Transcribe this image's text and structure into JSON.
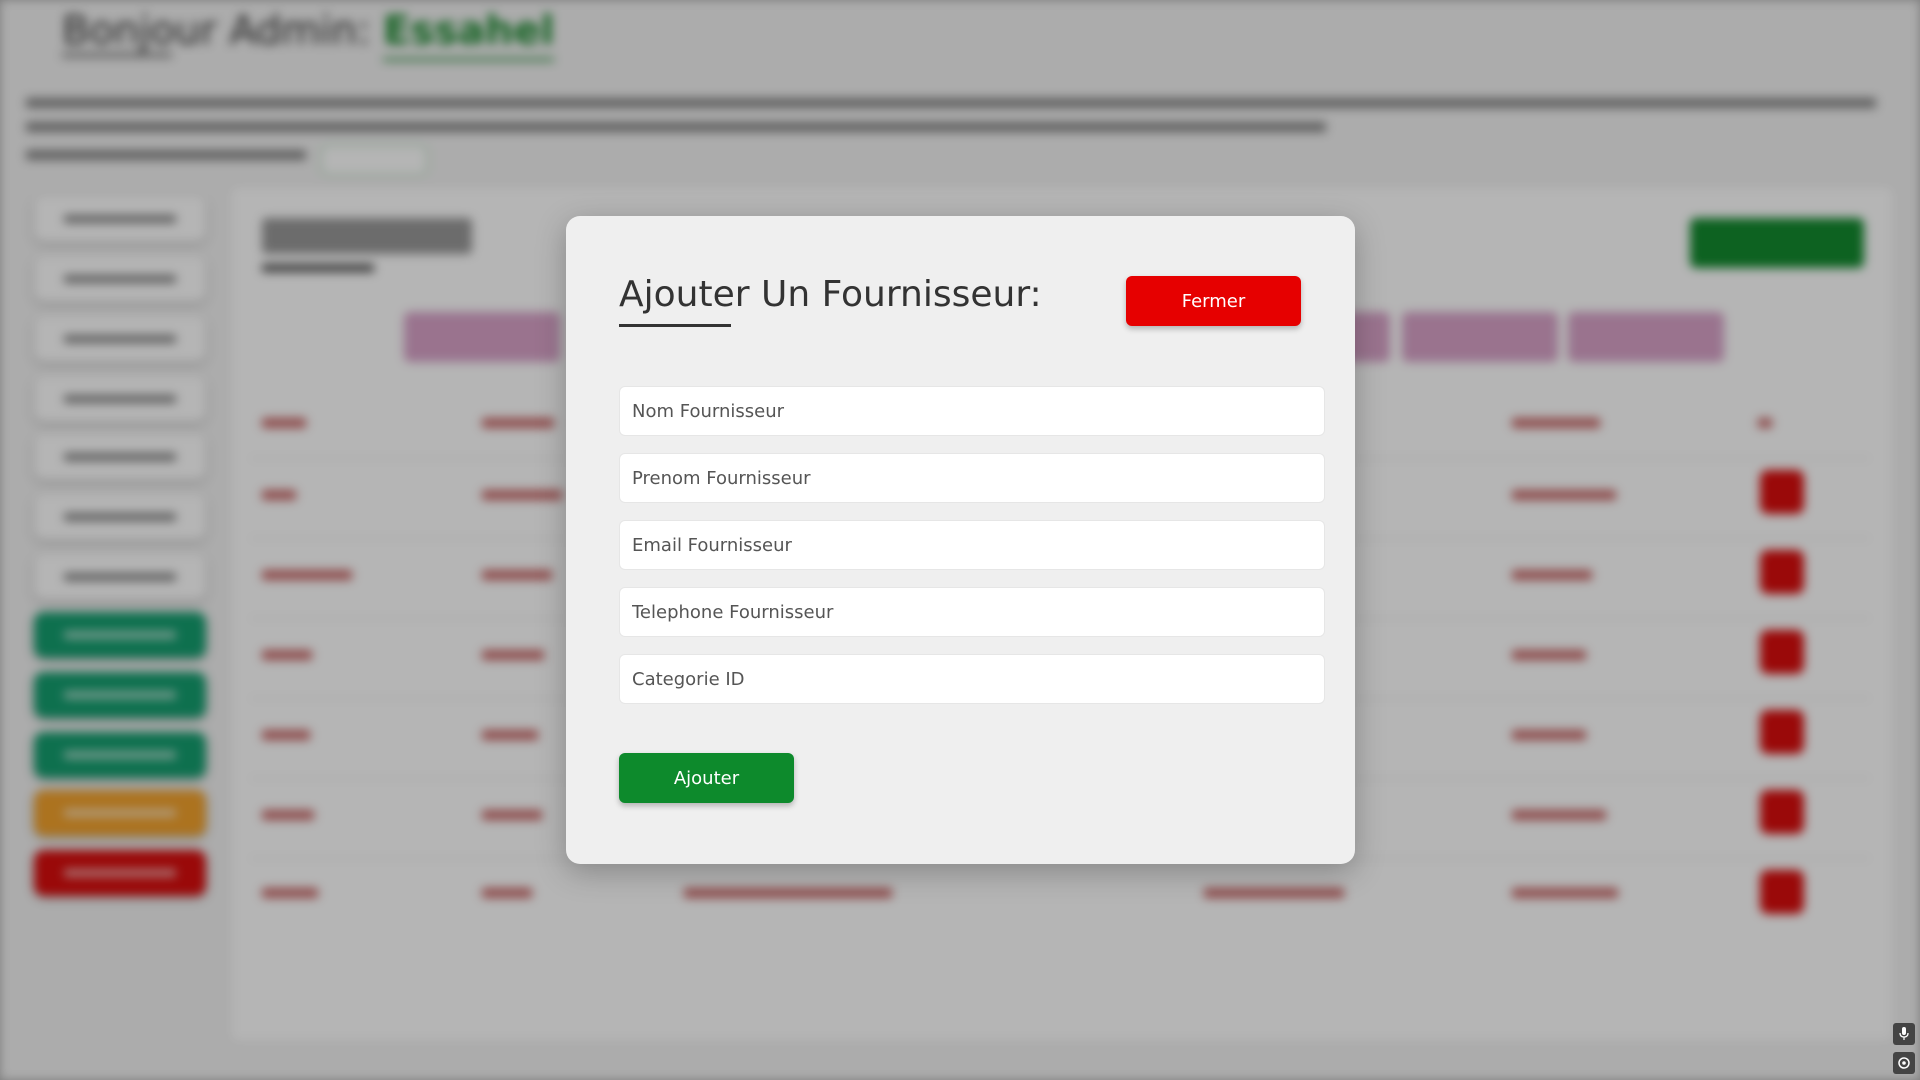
{
  "background": {
    "greeting_prefix": "Bonjour Admin:",
    "greeting_name": "Essahel"
  },
  "modal": {
    "title": "Ajouter Un Fournisseur:",
    "close_label": "Fermer",
    "fields": {
      "nom_placeholder": "Nom Fournisseur",
      "prenom_placeholder": "Prenom Fournisseur",
      "email_placeholder": "Email Fournisseur",
      "telephone_placeholder": "Telephone Fournisseur",
      "categorie_placeholder": "Categorie ID"
    },
    "submit_label": "Ajouter"
  },
  "colors": {
    "close_button": "#e60000",
    "submit_button": "#0d8a2c",
    "accent_green": "#1b8a2f"
  },
  "corner_icons": [
    "microphone-icon",
    "settings-icon"
  ]
}
